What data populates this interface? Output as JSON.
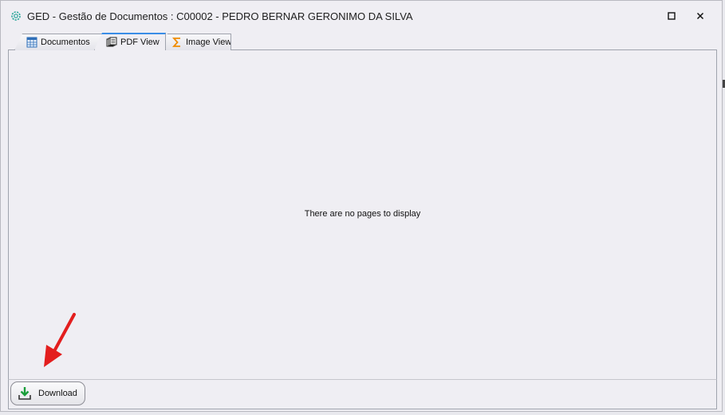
{
  "window": {
    "title": "GED - Gestão de Documentos : C00002 - PEDRO BERNAR GERONIMO DA SILVA",
    "icons": {
      "app": "gear-icon",
      "maximize": "maximize-icon",
      "close": "close-icon"
    }
  },
  "tabs": [
    {
      "label": "Documentos",
      "icon": "table-icon",
      "active": false
    },
    {
      "label": "PDF View",
      "icon": "document-stack-icon",
      "active": true
    },
    {
      "label": "Image View",
      "icon": "sigma-icon",
      "active": false
    }
  ],
  "viewer": {
    "empty_message": "There are no pages to display"
  },
  "toolbar": {
    "download_label": "Download",
    "download_icon": "download-icon"
  },
  "colors": {
    "accent": "#3a8de6",
    "annotation_arrow": "#e31e1e",
    "download_icon": "#1a9e3a"
  }
}
